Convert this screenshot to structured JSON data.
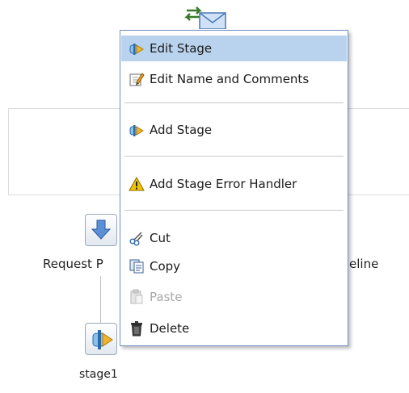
{
  "canvas": {
    "request_label": "Request P",
    "pipeline_label_fragment": "eline",
    "stage_label": "stage1"
  },
  "menu": {
    "items": [
      {
        "label": "Edit Stage",
        "icon": "stage-icon",
        "selected": true,
        "enabled": true
      },
      {
        "label": "Edit Name and Comments",
        "icon": "edit-pencil-icon",
        "selected": false,
        "enabled": true
      },
      {
        "label": "Add Stage",
        "icon": "stage-icon",
        "selected": false,
        "enabled": true
      },
      {
        "label": "Add Stage Error Handler",
        "icon": "warning-icon",
        "selected": false,
        "enabled": true
      },
      {
        "label": "Cut",
        "icon": "scissors-icon",
        "selected": false,
        "enabled": true
      },
      {
        "label": "Copy",
        "icon": "copy-icon",
        "selected": false,
        "enabled": true
      },
      {
        "label": "Paste",
        "icon": "paste-icon",
        "selected": false,
        "enabled": false
      },
      {
        "label": "Delete",
        "icon": "trash-icon",
        "selected": false,
        "enabled": true
      }
    ]
  },
  "colors": {
    "selection": "#b9d3ee",
    "menu_border": "#6f8fbf",
    "disabled_text": "#a8a8a8"
  }
}
